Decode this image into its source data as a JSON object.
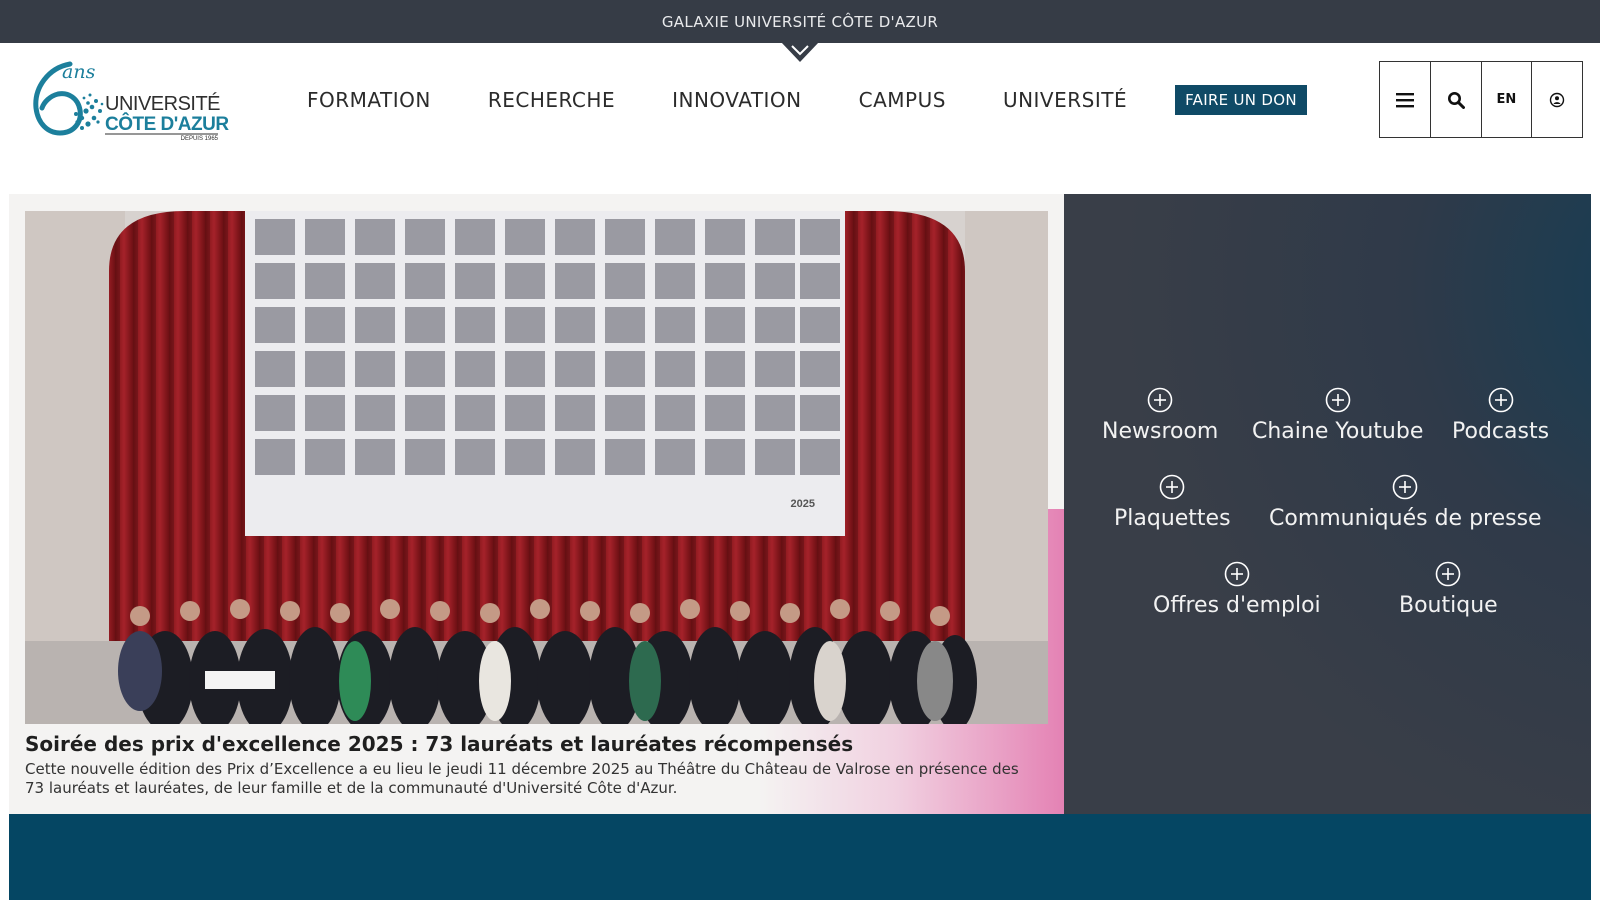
{
  "galaxy_bar": {
    "label": "GALAXIE UNIVERSITÉ CÔTE D'AZUR"
  },
  "logo": {
    "line1": "UNIVERSITÉ",
    "line2": "CÔTE D'AZUR",
    "anniversary": "6",
    "ans": "ans",
    "since": "DEPUIS 1965"
  },
  "nav": {
    "items": [
      "FORMATION",
      "RECHERCHE",
      "INNOVATION",
      "CAMPUS",
      "UNIVERSITÉ"
    ],
    "donate": "FAIRE UN DON"
  },
  "toolbar": {
    "menu_icon": "hamburger-icon",
    "search_icon": "search-icon",
    "lang": "EN",
    "account_icon": "user-circle-icon"
  },
  "hero": {
    "title": "Soirée des prix d'excellence 2025 : 73 lauréats et lauréates récompensés",
    "text": "Cette nouvelle édition des Prix d’Excellence a eu lieu le jeudi 11 décembre 2025 au Théâtre du Château de Valrose en présence des 73 lauréats et lauréates, de leur famille et de la communauté d'Université Côte d'Azur.",
    "screen_year": "2025"
  },
  "quick_links": [
    "Newsroom",
    "Chaine Youtube",
    "Podcasts",
    "Plaquettes",
    "Communiqués de presse",
    "Offres d'emploi",
    "Boutique"
  ],
  "colors": {
    "dark": "#363c46",
    "brand_blue": "#0f4a66",
    "bottom_band": "#054663",
    "logo_teal": "#1c7f9c"
  }
}
